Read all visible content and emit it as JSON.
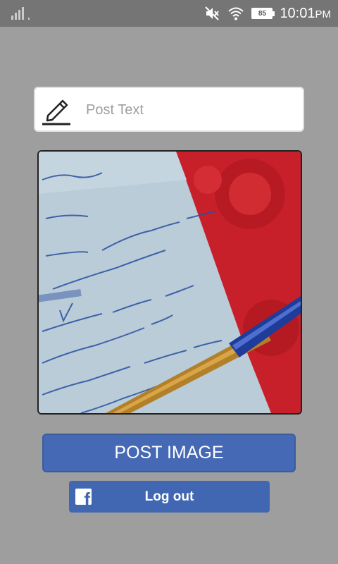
{
  "status_bar": {
    "battery_level": "85",
    "time": "10:01",
    "ampm": "PM",
    "icons": [
      "signal-icon",
      "mute-icon",
      "wifi-icon",
      "battery-icon"
    ]
  },
  "post": {
    "placeholder": "Post Text",
    "value": ""
  },
  "image": {
    "description_icon": "photo-of-handwritten-notes-with-pen"
  },
  "buttons": {
    "post_image": "POST IMAGE",
    "logout": "Log out",
    "facebook_icon": "facebook-icon"
  },
  "colors": {
    "background": "#9e9e9e",
    "status_bar": "#757575",
    "post_button": "#4569b4",
    "facebook_blue": "#4267b2"
  }
}
